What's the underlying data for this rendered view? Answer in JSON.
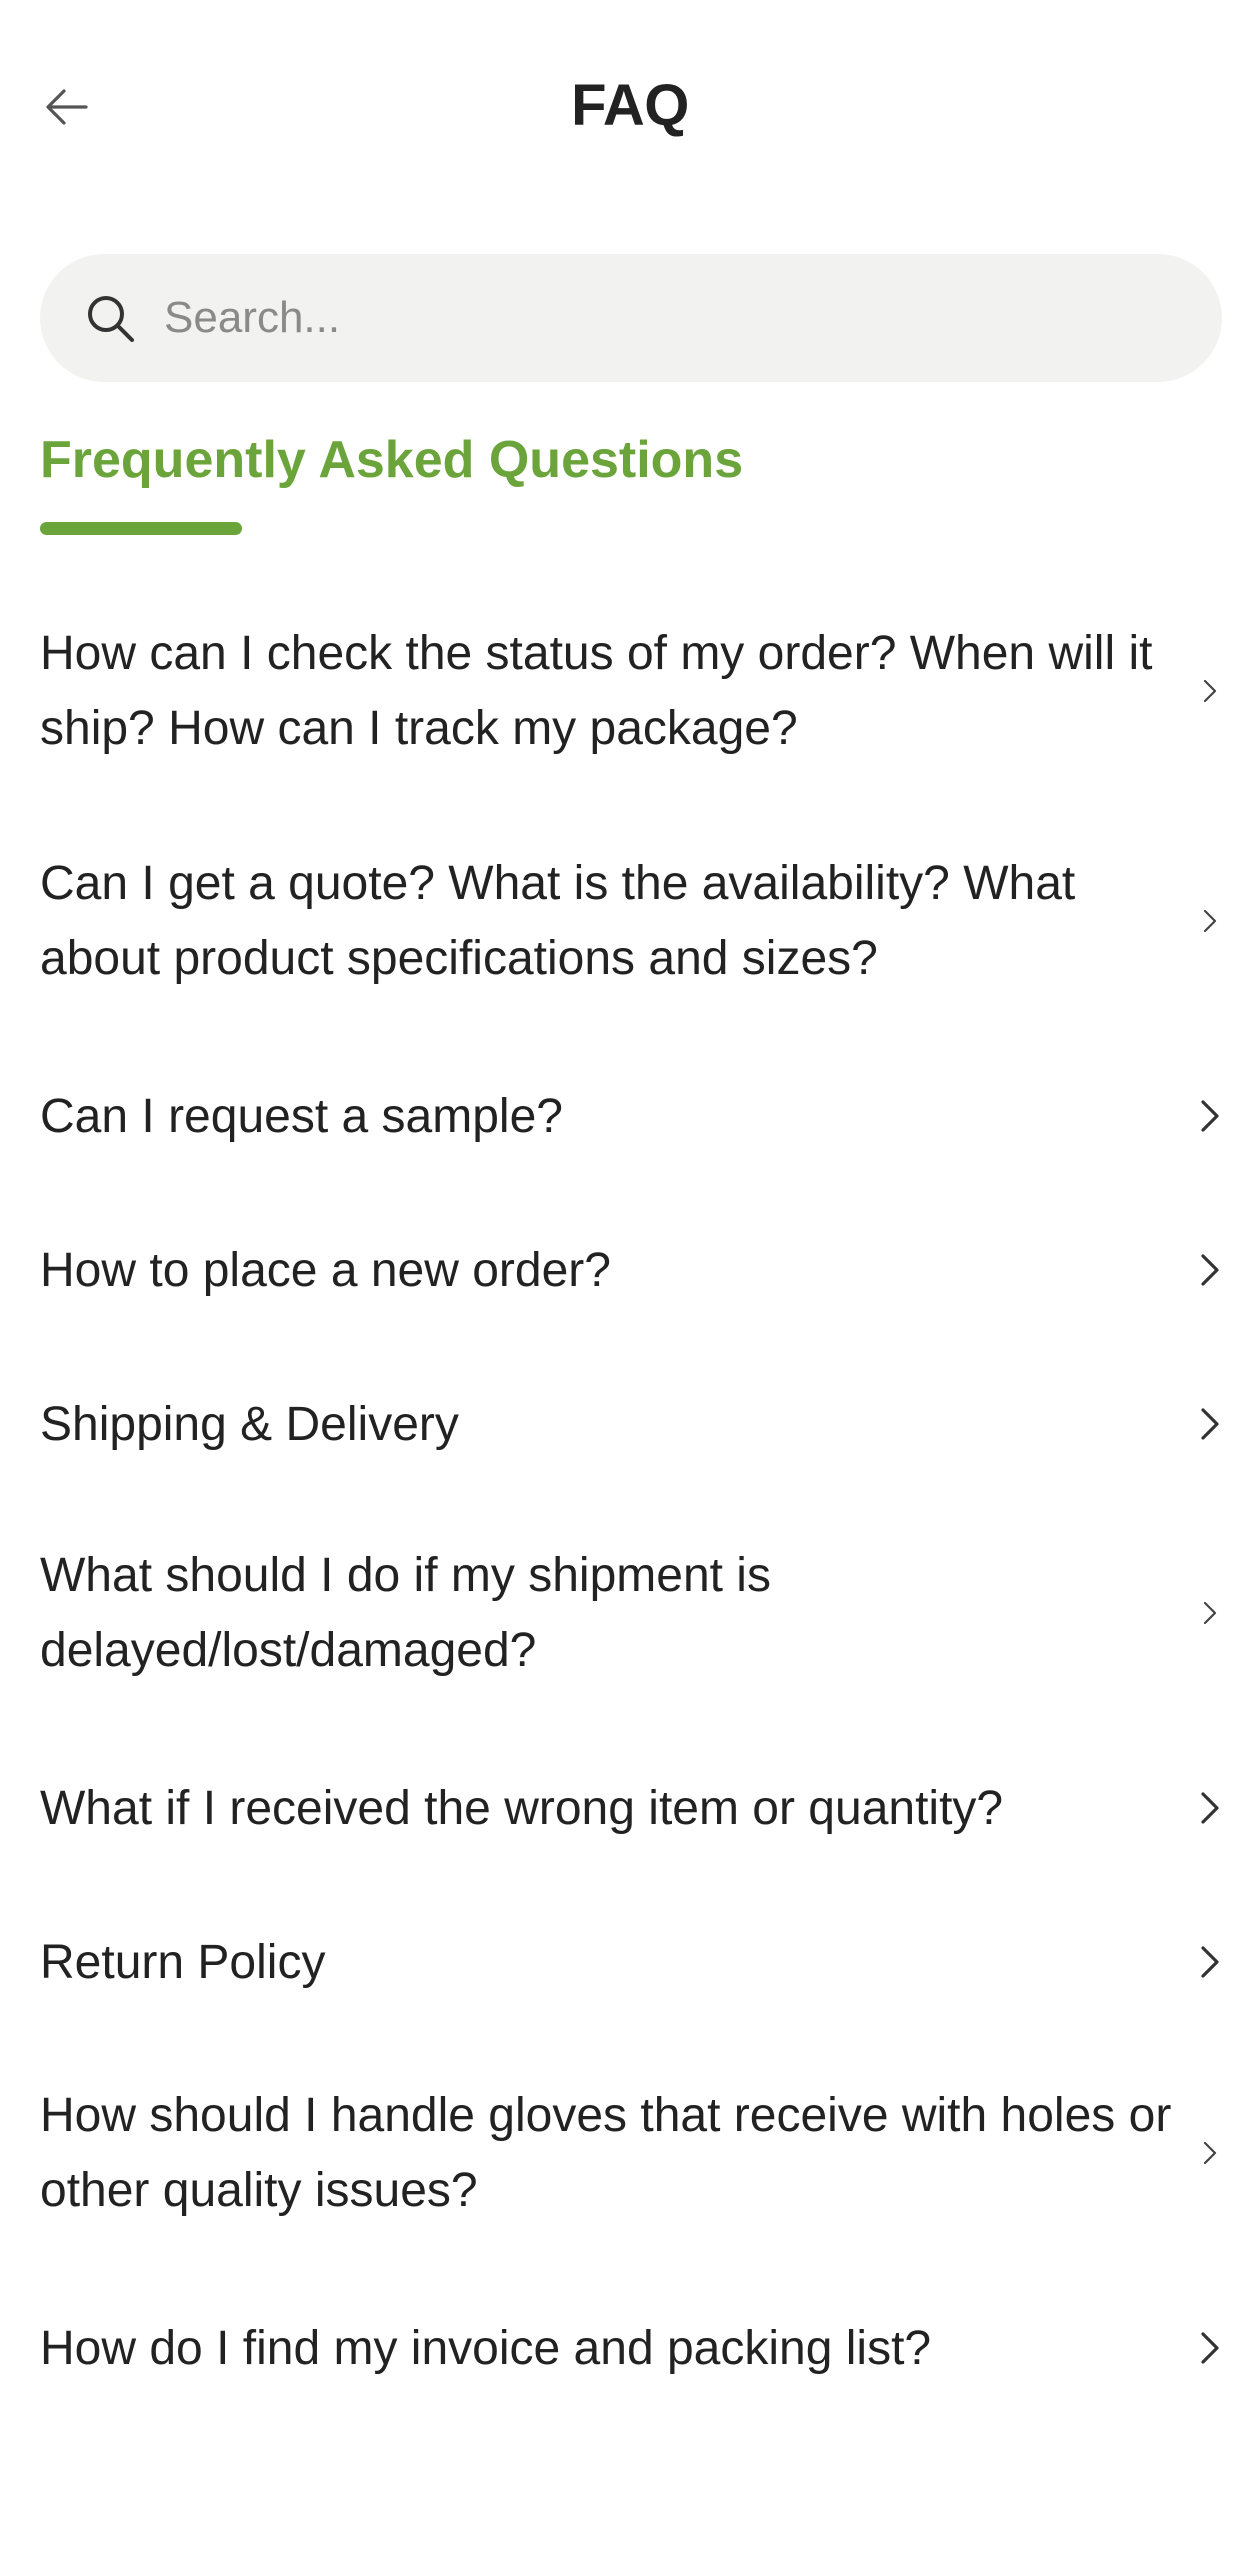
{
  "header": {
    "title": "FAQ",
    "back_icon": "arrow-left-icon"
  },
  "search": {
    "placeholder": "Search...",
    "value": "",
    "icon": "search-icon"
  },
  "section": {
    "title": "Frequently Asked Questions",
    "accent_color": "#6ba43a"
  },
  "faq": {
    "items": [
      {
        "question": "How can I check the status of my order? When will it ship? How can I track my package?"
      },
      {
        "question": "Can I get a quote? What is the availability? What about product specifications and sizes?"
      },
      {
        "question": "Can I request a sample?"
      },
      {
        "question": "How to place a new order?"
      },
      {
        "question": "Shipping & Delivery"
      },
      {
        "question": "What should I do if my shipment is delayed/lost/damaged?"
      },
      {
        "question": "What if I received the wrong item or quantity?"
      },
      {
        "question": "Return Policy"
      },
      {
        "question": "How should I handle gloves that receive with holes or other quality issues?"
      },
      {
        "question": "How do I find my invoice and packing list?"
      }
    ],
    "chevron_icon": "chevron-right-icon"
  }
}
